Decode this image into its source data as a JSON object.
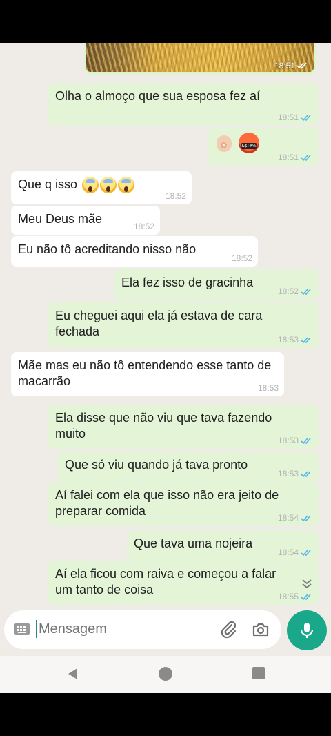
{
  "chat": {
    "image_message": {
      "time": "18:51",
      "status": "read"
    },
    "messages": [
      {
        "dir": "out",
        "text": "Olha o almoço que sua esposa fez aí",
        "time": "18:51",
        "status": "read"
      },
      {
        "dir": "out",
        "emoji": [
          "ok-hand-emoji",
          "angry-swearing-emoji"
        ],
        "emoji_text": "&$!#%",
        "time": "18:51",
        "status": "read"
      },
      {
        "dir": "in",
        "text": "Que q isso",
        "emoji": [
          "scream-emoji",
          "scream-emoji",
          "scream-emoji"
        ],
        "time": "18:52"
      },
      {
        "dir": "in",
        "text": "Meu Deus mãe",
        "time": "18:52"
      },
      {
        "dir": "in",
        "text": "Eu não tô acreditando nisso não",
        "time": "18:52"
      },
      {
        "dir": "out",
        "text": "Ela fez isso de gracinha",
        "time": "18:52",
        "status": "read"
      },
      {
        "dir": "out",
        "text": "Eu cheguei aqui ela já estava de cara fechada",
        "time": "18:53",
        "status": "read"
      },
      {
        "dir": "in",
        "text": "Mãe mas eu não tô entendendo esse tanto de macarrão",
        "time": "18:53"
      },
      {
        "dir": "out",
        "text": "Ela disse que não viu que tava fazendo muito",
        "time": "18:53",
        "status": "read"
      },
      {
        "dir": "out",
        "text": "Que só viu quando já tava pronto",
        "time": "18:53",
        "status": "read"
      },
      {
        "dir": "out",
        "text": "Aí falei com ela que isso não era jeito de preparar comida",
        "time": "18:54",
        "status": "read"
      },
      {
        "dir": "out",
        "text": "Que tava uma nojeira",
        "time": "18:54",
        "status": "read"
      },
      {
        "dir": "out",
        "text": "Aí ela ficou com raiva e começou a falar um tanto de coisa",
        "time": "18:55",
        "status": "read"
      }
    ]
  },
  "input": {
    "placeholder": "Mensagem",
    "value": ""
  },
  "icons": {
    "keyboard": "keyboard-icon",
    "attach": "paperclip-icon",
    "camera": "camera-icon",
    "mic": "microphone-icon",
    "scroll": "double-chevron-down-icon",
    "nav_back": "back-triangle-icon",
    "nav_home": "home-circle-icon",
    "nav_recent": "recents-square-icon"
  },
  "colors": {
    "chat_bg": "#efece8",
    "outgoing_bubble": "#e3f4d7",
    "incoming_bubble": "#ffffff",
    "read_tick": "#4fb6ec",
    "accent": "#1aa88a"
  }
}
